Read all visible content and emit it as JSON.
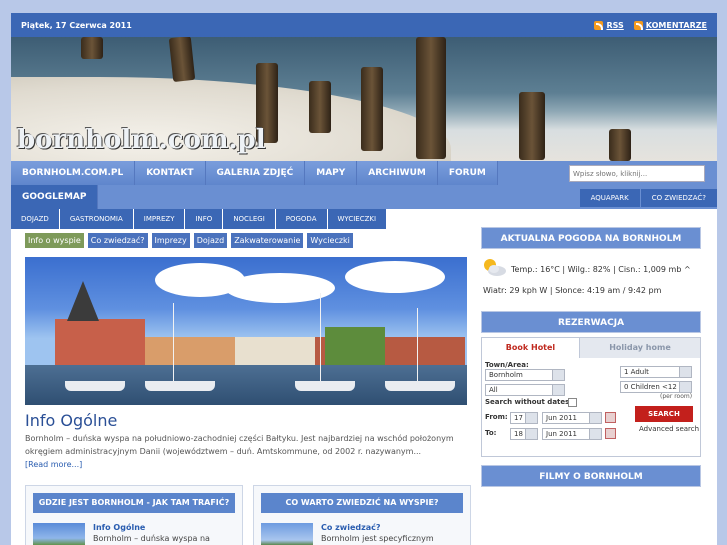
{
  "topbar": {
    "date": "Piątek, 17 Czerwca 2011",
    "rss": "RSS",
    "comments": "KOMENTARZE"
  },
  "banner": {
    "site_title": "bornholm.com.pl"
  },
  "mainnav": {
    "items": [
      "BORNHOLM.COM.PL",
      "KONTAKT",
      "GALERIA ZDJĘĆ",
      "MAPY",
      "ARCHIWUM",
      "FORUM",
      "GOOGLEMAP"
    ],
    "search_placeholder": "Wpisz słowo, kliknij...",
    "subtabs": [
      "AQUAPARK",
      "CO ZWIEDZAĆ?"
    ]
  },
  "secnav": {
    "items": [
      "DOJAZD",
      "GASTRONOMIA",
      "IMPREZY",
      "INFO",
      "NOCLEGI",
      "POGODA",
      "WYCIECZKI"
    ]
  },
  "pills": [
    "Info o wyspie",
    "Co zwiedzać?",
    "Imprezy",
    "Dojazd",
    "Zakwaterowanie",
    "Wycieczki"
  ],
  "article": {
    "title": "Info Ogólne",
    "text": "Bornholm – duńska wyspa na południowo-zachodniej części Bałtyku. Jest najbardziej na wschód położonym okręgiem administracyjnym Danii (województwem – duń. Amtskommune, od 2002 r. nazywanym...",
    "readmore": "[Read more...]"
  },
  "box1": {
    "header": "GDZIE JEST BORNHOLM - JAK TAM TRAFIĆ?",
    "title": "Info Ogólne",
    "text": "Bornholm – duńska wyspa na"
  },
  "box2": {
    "header": "CO WARTO ZWIEDZIĆ NA WYSPIE?",
    "title": "Co zwiedzać?",
    "text": "Bornholm jest specyficznym"
  },
  "weather": {
    "header": "AKTUALNA POGODA NA BORNHOLM",
    "line1": "Temp.: 16°C | Wilg.: 82% | Cisn.: 1,009 mb ^",
    "line2": "Wiatr: 29 kph W | Słonce: 4:19 am / 9:42 pm",
    "icon": "partly-cloudy-icon"
  },
  "reservation": {
    "header": "REZERWACJA",
    "tab_book": "Book Hotel",
    "tab_home": "Holiday home",
    "town_label": "Town/Area:",
    "town1": "Bornholm",
    "town2": "All",
    "without_dates": "Search without dates:",
    "adults": "1 Adult",
    "children": "0 Children <12",
    "per_room": "(per room)",
    "from_label": "From:",
    "to_label": "To:",
    "from_day": "17",
    "from_month": "Jun 2011",
    "to_day": "18",
    "to_month": "Jun 2011",
    "search": "SEARCH",
    "advanced": "Advanced search"
  },
  "films": {
    "header": "FILMY O BORNHOLM"
  }
}
